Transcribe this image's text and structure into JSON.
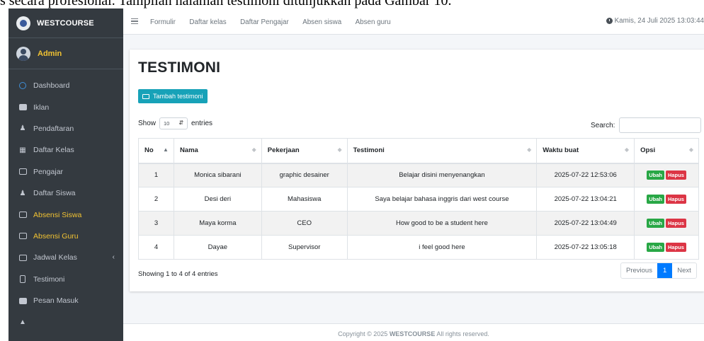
{
  "doc_caption": "s secara profesional. Tampilan halaman testimoni ditunjukkan pada Gambar 10.",
  "brand": {
    "name": "WESTCOURSE"
  },
  "user": {
    "name": "Admin"
  },
  "sidebar": {
    "items": [
      {
        "label": "Dashboard",
        "icon": "dashboard-icon"
      },
      {
        "label": "Iklan",
        "icon": "image-icon"
      },
      {
        "label": "Pendaftaran",
        "icon": "users-icon"
      },
      {
        "label": "Daftar Kelas",
        "icon": "building-icon"
      },
      {
        "label": "Pengajar",
        "icon": "presentation-icon"
      },
      {
        "label": "Daftar Siswa",
        "icon": "users-group-icon"
      },
      {
        "label": "Absensi Siswa",
        "icon": "list-icon"
      },
      {
        "label": "Absensi Guru",
        "icon": "list-icon"
      },
      {
        "label": "Jadwal Kelas",
        "icon": "calendar-icon"
      },
      {
        "label": "Testimoni",
        "icon": "comment-icon"
      },
      {
        "label": "Pesan Masuk",
        "icon": "inbox-icon"
      },
      {
        "label": "",
        "icon": "cap-icon"
      }
    ]
  },
  "topnav": {
    "links": [
      "Formulir",
      "Daftar kelas",
      "Daftar Pengajar",
      "Absen siswa",
      "Absen guru"
    ],
    "datetime": "Kamis, 24 Juli 2025 13:03:44"
  },
  "page": {
    "title": "TESTIMONI",
    "add_button": "Tambah testimoni",
    "show_prefix": "Show",
    "show_value": "10",
    "show_suffix": "entries",
    "search_label": "Search:",
    "search_value": ""
  },
  "table": {
    "columns": [
      "No",
      "Nama",
      "Pekerjaan",
      "Testimoni",
      "Waktu buat",
      "Opsi"
    ],
    "rows": [
      {
        "no": "1",
        "nama": "Monica sibarani",
        "pekerjaan": "graphic desainer",
        "testimoni": "Belajar disini menyenangkan",
        "waktu": "2025-07-22 12:53:06"
      },
      {
        "no": "2",
        "nama": "Desi deri",
        "pekerjaan": "Mahasiswa",
        "testimoni": "Saya belajar bahasa inggris dari west course",
        "waktu": "2025-07-22 13:04:21"
      },
      {
        "no": "3",
        "nama": "Maya korma",
        "pekerjaan": "CEO",
        "testimoni": "How good to be a student here",
        "waktu": "2025-07-22 13:04:49"
      },
      {
        "no": "4",
        "nama": "Dayae",
        "pekerjaan": "Supervisor",
        "testimoni": "i feel good here",
        "waktu": "2025-07-22 13:05:18"
      }
    ],
    "edit_label": "Ubah",
    "delete_label": "Hapus"
  },
  "info": "Showing 1 to 4 of 4 entries",
  "pagination": {
    "previous": "Previous",
    "current": "1",
    "next": "Next"
  },
  "footer": {
    "prefix": "Copyright © 2025 ",
    "brand": "WESTCOURSE",
    "suffix": " All rights reserved."
  },
  "colors": {
    "sidebar": "#343a40",
    "accent": "#17a2b8",
    "primary": "#007bff",
    "success": "#28a745",
    "danger": "#dc3545",
    "highlight": "#f1c232"
  }
}
